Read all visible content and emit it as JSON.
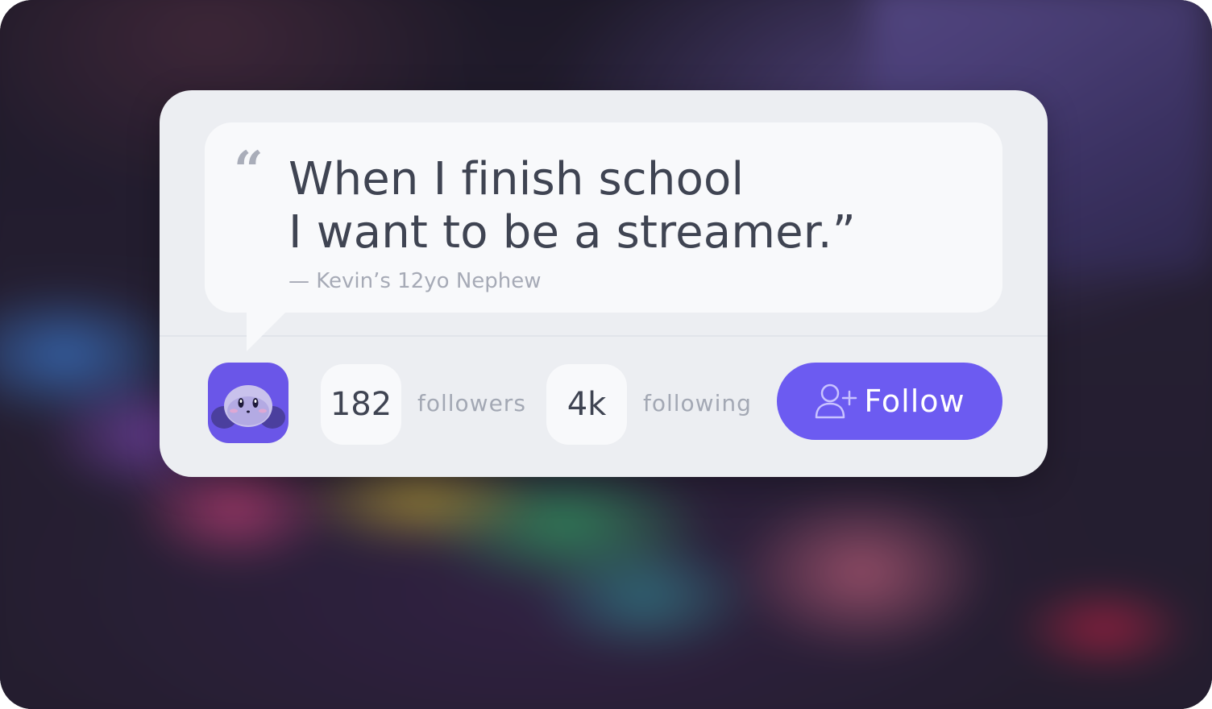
{
  "quote": {
    "mark": "“",
    "line1": "When I finish school",
    "line2": "I want to be a streamer.”",
    "attribution": "— Kevin’s 12yo Nephew"
  },
  "profile": {
    "avatar_icon": "ghost-character-icon",
    "followers_count": "182",
    "followers_label": "followers",
    "following_count": "4k",
    "following_label": "following"
  },
  "follow_button": {
    "label": "Follow",
    "icon": "add-user-icon"
  },
  "colors": {
    "accent": "#6c5bf1",
    "card": "#eceef2",
    "bubble": "#f8f9fb",
    "text": "#3f4452",
    "muted": "#a3a8b4"
  }
}
